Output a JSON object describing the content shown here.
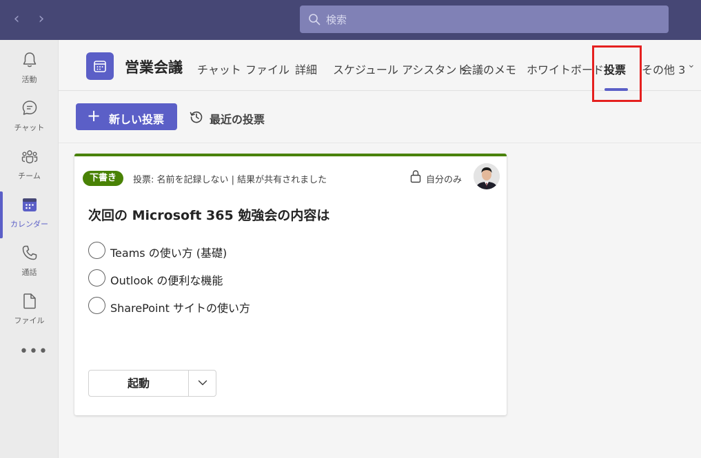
{
  "search": {
    "placeholder": "検索"
  },
  "rail": {
    "items": [
      {
        "label": "活動",
        "icon": "bell-icon"
      },
      {
        "label": "チャット",
        "icon": "chat-icon"
      },
      {
        "label": "チーム",
        "icon": "teams-icon"
      },
      {
        "label": "カレンダー",
        "icon": "calendar-icon",
        "active": true
      },
      {
        "label": "通話",
        "icon": "phone-icon"
      },
      {
        "label": "ファイル",
        "icon": "file-icon"
      }
    ],
    "more": "•••"
  },
  "header": {
    "title": "営業会議",
    "tabs": [
      {
        "label": "チャット"
      },
      {
        "label": "ファイル"
      },
      {
        "label": "詳細"
      },
      {
        "label": "スケジュール アシスタント"
      },
      {
        "label": "会議のメモ"
      },
      {
        "label": "ホワイトボード"
      },
      {
        "label": "投票",
        "active": true
      },
      {
        "label": "その他 3"
      }
    ]
  },
  "toolbar": {
    "new_poll": "新しい投票",
    "recent_polls": "最近の投票"
  },
  "poll": {
    "status": "下書き",
    "meta": "投票: 名前を記録しない | 結果が共有されました",
    "visibility": "自分のみ",
    "question": "次回の Microsoft 365 勉強会の内容は",
    "options": [
      "Teams の使い方 (基礎)",
      "Outlook の便利な機能",
      "SharePoint サイトの使い方"
    ],
    "launch": "起動"
  },
  "colors": {
    "topbar": "#464775",
    "brand": "#5b5fc7",
    "draft_green": "#498205",
    "highlight": "#e5201f"
  }
}
